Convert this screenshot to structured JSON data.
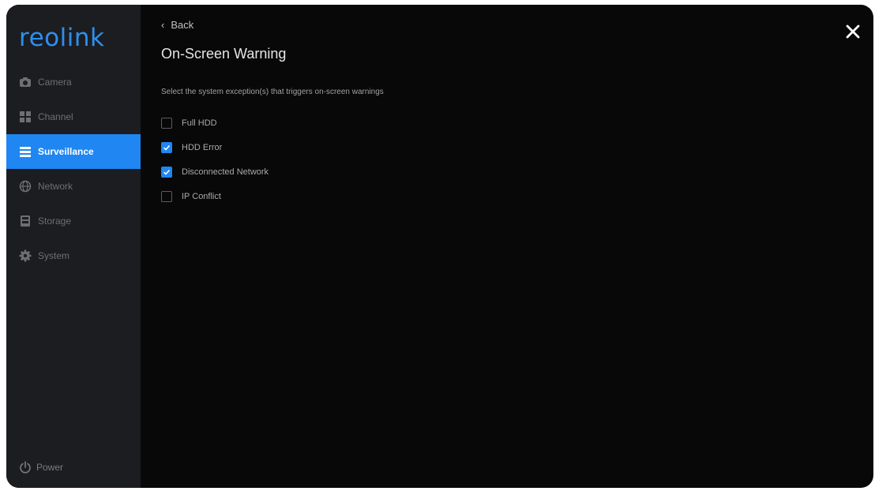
{
  "brand": {
    "logo_text": "reolink",
    "accent": "#1f86f2"
  },
  "sidebar": {
    "items": [
      {
        "label": "Camera",
        "icon": "camera-icon",
        "active": false
      },
      {
        "label": "Channel",
        "icon": "channel-icon",
        "active": false
      },
      {
        "label": "Surveillance",
        "icon": "surveillance-icon",
        "active": true
      },
      {
        "label": "Network",
        "icon": "network-icon",
        "active": false
      },
      {
        "label": "Storage",
        "icon": "storage-icon",
        "active": false
      },
      {
        "label": "System",
        "icon": "gear-icon",
        "active": false
      }
    ],
    "power_label": "Power"
  },
  "page": {
    "back_label": "Back",
    "title": "On-Screen Warning",
    "description": "Select the system exception(s) that triggers on-screen warnings",
    "options": [
      {
        "label": "Full HDD",
        "checked": false
      },
      {
        "label": "HDD Error",
        "checked": true
      },
      {
        "label": "Disconnected Network",
        "checked": true
      },
      {
        "label": "IP Conflict",
        "checked": false
      }
    ]
  },
  "controls": {
    "close_icon": "close-icon"
  }
}
